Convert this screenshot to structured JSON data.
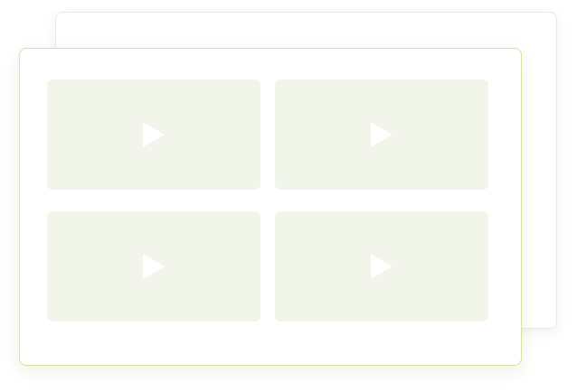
{
  "gallery": {
    "accent_color": "#d2e3a3",
    "tile_color": "#f1f5ea",
    "tiles": [
      {
        "icon": "play-icon"
      },
      {
        "icon": "play-icon"
      },
      {
        "icon": "play-icon"
      },
      {
        "icon": "play-icon"
      }
    ]
  }
}
